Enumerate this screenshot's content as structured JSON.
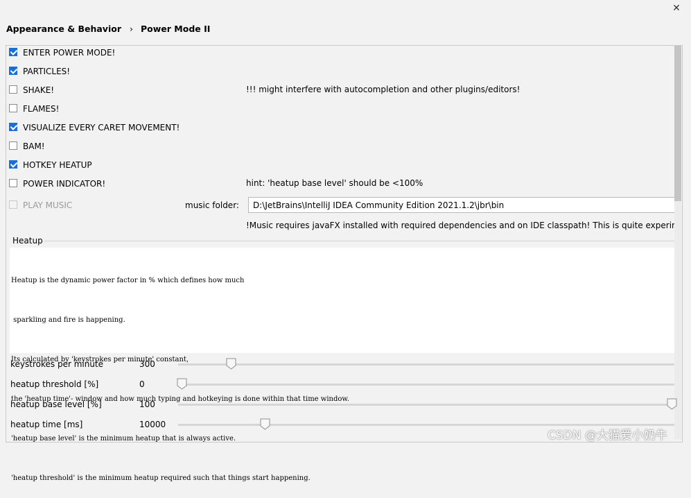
{
  "window": {
    "close_icon": "close-icon"
  },
  "breadcrumb": {
    "parent": "Appearance & Behavior",
    "separator": "›",
    "current": "Power Mode II"
  },
  "options": [
    {
      "label": "ENTER POWER MODE!",
      "checked": true
    },
    {
      "label": "PARTICLES!",
      "checked": true
    },
    {
      "label": "SHAKE!",
      "checked": false,
      "note": "!!! might interfere with autocompletion and other plugins/editors!"
    },
    {
      "label": "FLAMES!",
      "checked": false
    },
    {
      "label": "VISUALIZE EVERY CARET MOVEMENT!",
      "checked": true
    },
    {
      "label": "BAM!",
      "checked": false
    },
    {
      "label": "HOTKEY HEATUP",
      "checked": true
    },
    {
      "label": "POWER INDICATOR!",
      "checked": false,
      "note": "hint: 'heatup base level' should be <100%"
    },
    {
      "label": "PLAY MUSIC",
      "checked": false,
      "disabled": true
    }
  ],
  "music": {
    "label": "music folder:",
    "path": "D:\\JetBrains\\IntelliJ IDEA Community Edition 2021.1.2\\jbr\\bin",
    "note": "!Music requires javaFX installed with required dependencies and on IDE classpath! This is quite experimen"
  },
  "heatup": {
    "title": "Heatup",
    "lines": [
      "Heatup is the dynamic power factor in % which defines how much",
      " sparkling and fire is happening.",
      "Its calculated by 'keystrokes per minute' constant,",
      "the 'heatup time'- window and how much typing and hotkeying is done within that time window.",
      "'heatup base level' is the minimum heatup that is always active.",
      "'heatup threshold' is the minimum heatup required such that things start happening."
    ]
  },
  "sliders": [
    {
      "label": "keystrokes per minute",
      "value": "300",
      "fraction": 0.1
    },
    {
      "label": "heatup threshold [%]",
      "value": "0",
      "fraction": 0.0
    },
    {
      "label": "heatup base level [%]",
      "value": "100",
      "fraction": 1.0
    },
    {
      "label": "heatup time [ms]",
      "value": "10000",
      "fraction": 0.17
    }
  ],
  "watermark": "CSDN @大猫爱小奶牛",
  "colors": {
    "accent": "#1a6fd6",
    "background": "#f2f2f2"
  }
}
